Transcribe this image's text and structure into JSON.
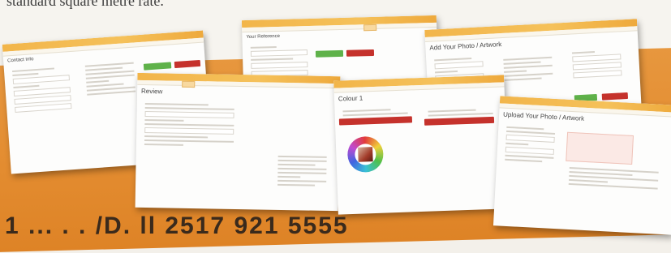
{
  "captions": {
    "top": "standard square metre rate.",
    "bottom": "1 ... . . /D. ll 2517 921 5555"
  },
  "colors": {
    "accent_orange": "#e38c30",
    "header_bar": "#f2b54a",
    "button_green": "#5fb24a",
    "button_red": "#c5322c"
  },
  "cards": {
    "c1": {
      "title": "Contact Info"
    },
    "c2": {
      "title": "Your Reference"
    },
    "c3": {
      "title": "Add Your Photo / Artwork"
    },
    "c4": {
      "title": "Review"
    },
    "c5": {
      "title": "Colour 1"
    },
    "c6": {
      "title": "Upload Your Photo / Artwork"
    }
  }
}
